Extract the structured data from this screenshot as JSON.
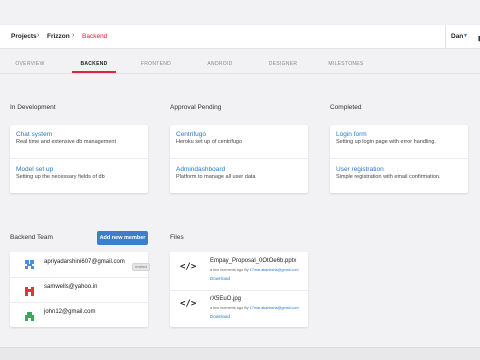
{
  "breadcrumb": {
    "projects": "Projects",
    "project": "Frizzon",
    "current": "Backend",
    "separator": "›"
  },
  "user": {
    "name": "Dan"
  },
  "tabs": [
    "OVERVIEW",
    "BACKEND",
    "FRONTEND",
    "ANDROID",
    "DESIGNER",
    "MILESTONES"
  ],
  "active_tab": "BACKEND",
  "columns": [
    {
      "title": "In Development",
      "items": [
        {
          "title": "Chat system",
          "desc": "Real time and extensive db management"
        },
        {
          "title": "Model set up",
          "desc": "Setting up the necessary fields of db"
        }
      ]
    },
    {
      "title": "Approval Pending",
      "items": [
        {
          "title": "Centrifugo",
          "desc": "Heroku set up of centrifugo"
        },
        {
          "title": "Admindashboard",
          "desc": "Platform to manage all user data"
        }
      ]
    },
    {
      "title": "Completed",
      "items": [
        {
          "title": "Login form",
          "desc": "Setting up login page with error handling."
        },
        {
          "title": "User registration",
          "desc": "Simple registration with email confirmation."
        }
      ]
    }
  ],
  "team": {
    "title": "Backend Team",
    "add_label": "Add new member",
    "members": [
      {
        "email": "apriyadarshini607@gmail.com",
        "badge": "invited",
        "avatar_color": "#4a8fd8"
      },
      {
        "email": "samwells@yahoo.in",
        "badge": "",
        "avatar_color": "#d83a3a"
      },
      {
        "email": "john12@gmail.com",
        "badge": "",
        "avatar_color": "#3aa85a"
      }
    ]
  },
  "files": {
    "title": "Files",
    "items": [
      {
        "name": "Empay_Proposal_0OtOe6b.pptx",
        "meta_prefix": "a few moments ago By",
        "meta_by": "17mar.akanksha@gmail.com",
        "download": "Download"
      },
      {
        "name": "rX5EuO.jpg",
        "meta_prefix": "a few moments ago By",
        "meta_by": "17mar.akanksha@gmail.com",
        "download": "Download"
      }
    ]
  },
  "colors": {
    "accent": "#e0243e",
    "link": "#2a78c8",
    "button": "#3b7fcc"
  }
}
